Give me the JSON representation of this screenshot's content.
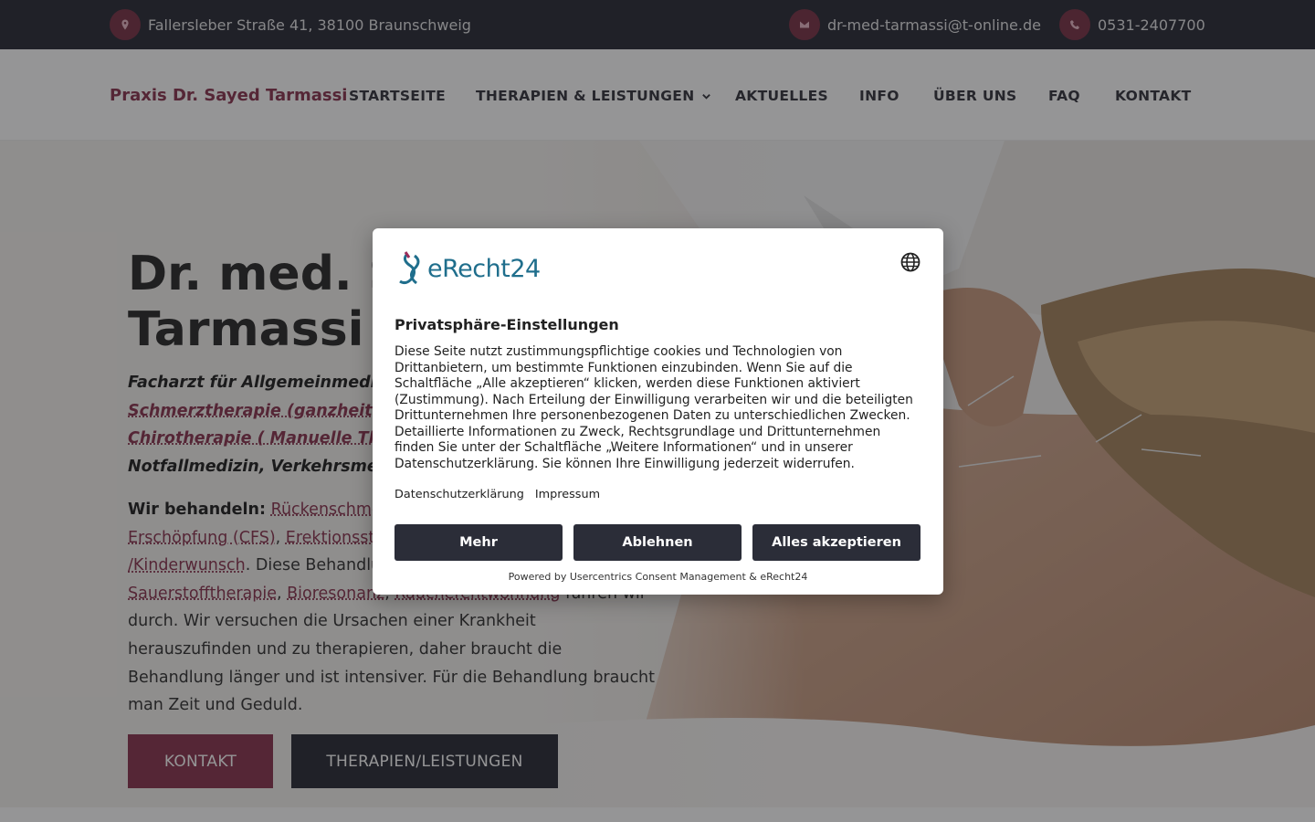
{
  "topbar": {
    "address": "Fallersleber Straße 41, 38100 Braunschweig",
    "email": "dr-med-tarmassi@t-online.de",
    "phone": "0531-2407700",
    "icons": [
      "location-pin-icon",
      "envelope-icon",
      "phone-icon"
    ]
  },
  "header": {
    "brand": "Praxis Dr. Sayed Tarmassi",
    "nav": [
      "STARTSEITE",
      "THERAPIEN & LEISTUNGEN",
      "AKTUELLES",
      "INFO",
      "ÜBER UNS",
      "FAQ",
      "KONTAKT"
    ]
  },
  "hero": {
    "headline_line1": "Dr. med. S",
    "headline_line2": "Tarmassi",
    "sub_line1": "Facharzt für Allgemeinmediz",
    "sub_line2": "Schmerztherapie (ganzheitl",
    "sub_line3": "Chirotherapie ( Manuelle Th",
    "sub_line4": "Notfallmedizin, Verkehrsme",
    "treat_label": "Wir behandeln:",
    "treat_link1": "Rückenschme",
    "treat_link2": "Erschöpfung (CFS)",
    "treat_link3": "Erektionsstö",
    "treat_link4": "/Kinderwunsch",
    "treat_text1": ". Diese Behandlu",
    "treat_link5": "Sauerstofftherapie",
    "treat_link6": "Bioresonanz",
    "treat_link7": "Raucherentwöhnung",
    "treat_text2": " führen wir",
    "body_line1": "durch. Wir versuchen die Ursachen einer Krankheit",
    "body_line2": "herauszufinden und zu therapieren, daher braucht die",
    "body_line3": "Behandlung länger und ist intensiver. Für die Behandlung braucht",
    "body_line4": "man Zeit und Geduld.",
    "btn_kontakt": "KONTAKT",
    "btn_therapien": "THERAPIEN/LEISTUNGEN"
  },
  "consent": {
    "logo_text": "eRecht24",
    "title": "Privatsphäre-Einstellungen",
    "desc_lines": [
      "Diese Seite nutzt zustimmungspflichtige cookies und Technologien von",
      "Drittanbietern, um bestimmte Funktionen einzubinden. Wenn Sie auf die",
      "Schaltfläche „Alle akzeptieren“ klicken, werden diese Funktionen aktiviert",
      "(Zustimmung). Nach Erteilung der Einwilligung verarbeiten wir und die beteiligten",
      "Drittunternehmen Ihre personenbezogenen Daten zu unterschiedlichen Zwecken.",
      "Detaillierte Informationen zu Zweck, Rechtsgrundlage und Drittunternehmen",
      "finden Sie unter der Schaltfläche „Weitere Informationen“ und in unserer",
      "Datenschutzerklärung. Sie können Ihre Einwilligung jederzeit widerrufen."
    ],
    "link_privacy": "Datenschutzerklärung",
    "link_imprint": "Impressum",
    "btn_more": "Mehr",
    "btn_decline": "Ablehnen",
    "btn_accept": "Alles akzeptieren",
    "powered": "Powered by Usercentrics Consent Management & eRecht24"
  },
  "colors": {
    "accent": "#8a3550",
    "dark": "#2b2d38",
    "logo": "#1f6e8c"
  }
}
